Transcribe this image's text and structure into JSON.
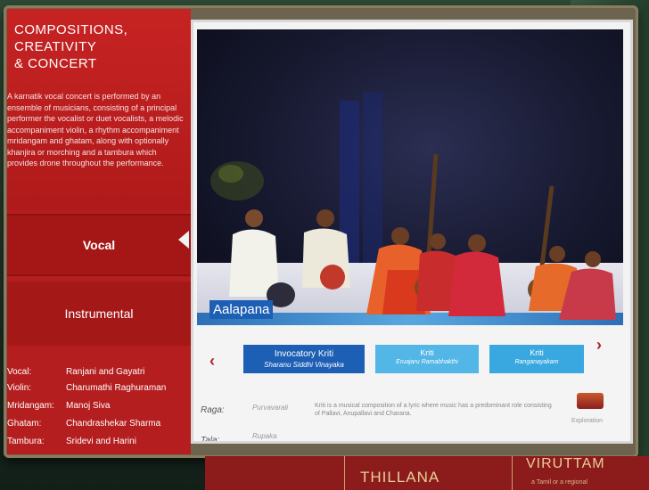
{
  "side": {
    "title_line1": "COMPOSITIONS,",
    "title_line2": "CREATIVITY",
    "title_line3": "& CONCERT",
    "description": "A karnatik vocal concert is performed by an ensemble of musicians, consisting of a principal performer the vocalist or duet vocalists, a melodic accompaniment violin, a rhythm accompaniment mridangam and ghatam, along with optionally khanjira or morching and a tambura which provides drone throughout the performance.",
    "tabs": [
      {
        "label": "Vocal"
      },
      {
        "label": "Instrumental"
      }
    ],
    "credits": [
      {
        "role": "Vocal:",
        "name": "Ranjani and Gayatri"
      },
      {
        "role": "Violin:",
        "name": "Charumathi Raghuraman"
      },
      {
        "role": "Mridangam:",
        "name": "Manoj Siva"
      },
      {
        "role": "Ghatam:",
        "name": "Chandrashekar Sharma"
      },
      {
        "role": "Tambura:",
        "name": "Sridevi and Harini"
      }
    ]
  },
  "video": {
    "caption": "Aalapana"
  },
  "carousel": {
    "cards": [
      {
        "title": "Invocatory Kriti",
        "subtitle": "Sharanu Siddhi Vinayaka"
      },
      {
        "title": "Kriti",
        "subtitle": "Eruajaru Ramabhakthi"
      },
      {
        "title": "Kriti",
        "subtitle": "Ranganayakam"
      }
    ]
  },
  "info": {
    "raga_label": "Raga:",
    "raga_value": "Purvavarali",
    "tala_label": "Tala:",
    "tala_value": "Rupaka",
    "description": "Kriti is a musical composition of a lyric where music has a predominant role consisting of Pallavi, Anupallavi and Charana.",
    "explore_label": "Exploration"
  },
  "bottom": {
    "item1": "THILLANA",
    "item2": "VIRUTTAM",
    "item2_sub": "a Tamil or a regional"
  },
  "colors": {
    "side_red": "#b51e1e",
    "accent_blue": "#1d5fb4",
    "light_blue": "#4ab3e6"
  }
}
